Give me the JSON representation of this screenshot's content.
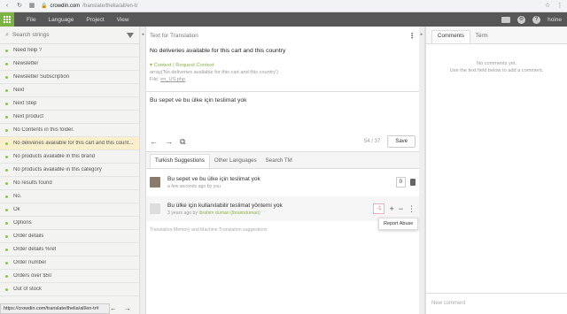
{
  "browser": {
    "domain": "crowdin.com",
    "path": "/translate/thelia/all/en-tr",
    "status_url": "https://crowdin.com/translate/thelia/all/en-tr#"
  },
  "header": {
    "menu": [
      "File",
      "Language",
      "Project",
      "View"
    ],
    "user": "hoine"
  },
  "sidebar": {
    "search_placeholder": "Search strings",
    "items": [
      {
        "label": "Need help ?"
      },
      {
        "label": "Newsletter"
      },
      {
        "label": "Newsletter Subscription"
      },
      {
        "label": "Next"
      },
      {
        "label": "Next Step"
      },
      {
        "label": "Next product"
      },
      {
        "label": "No Contents in this folder."
      },
      {
        "label": "No deliveries available for this cart and this count..."
      },
      {
        "label": "No products available in this brand"
      },
      {
        "label": "No products available in this category"
      },
      {
        "label": "No results found"
      },
      {
        "label": "No."
      },
      {
        "label": "Ok"
      },
      {
        "label": "Options"
      },
      {
        "label": "Order details"
      },
      {
        "label": "Order details %ref"
      },
      {
        "label": "Order number"
      },
      {
        "label": "Orders over $50"
      },
      {
        "label": "Out of stock"
      }
    ]
  },
  "editor": {
    "heading": "Text for Translation",
    "source": "No deliveries available for this cart and this country",
    "context_label": "Context",
    "context_action": "Request Context",
    "context_code": "array('No deliveries available for this cart and this country')",
    "file_label": "File:",
    "file_name": "en_US.php",
    "translation": "Bu sepet ve bu ülke için teslimat yok",
    "counter": "54 / 37",
    "save_label": "Save"
  },
  "suggestion_tabs": [
    "Turkish Suggestions",
    "Other Languages",
    "Search TM"
  ],
  "suggestions": [
    {
      "text": "Bu sepet ve bu ülke için teslimat yok",
      "meta_prefix": "a few seconds ago by you",
      "meta_user": "",
      "votes": "0"
    },
    {
      "text": "Bu ülke için kullanılabilir teslimat yöntemi yok",
      "meta_prefix": "3 years ago by",
      "meta_user": "ibrahim duman (ibraimduman)",
      "votes": "-1"
    }
  ],
  "tooltip": "Report Abuse",
  "tm_note": "Translation Memory and Machine Translation suggestions",
  "comments": {
    "tabs": [
      "Comments",
      "Term"
    ],
    "empty_line1": "No comments yet.",
    "empty_line2": "Use the text field below to add a comment.",
    "new_comment_placeholder": "New comment"
  }
}
